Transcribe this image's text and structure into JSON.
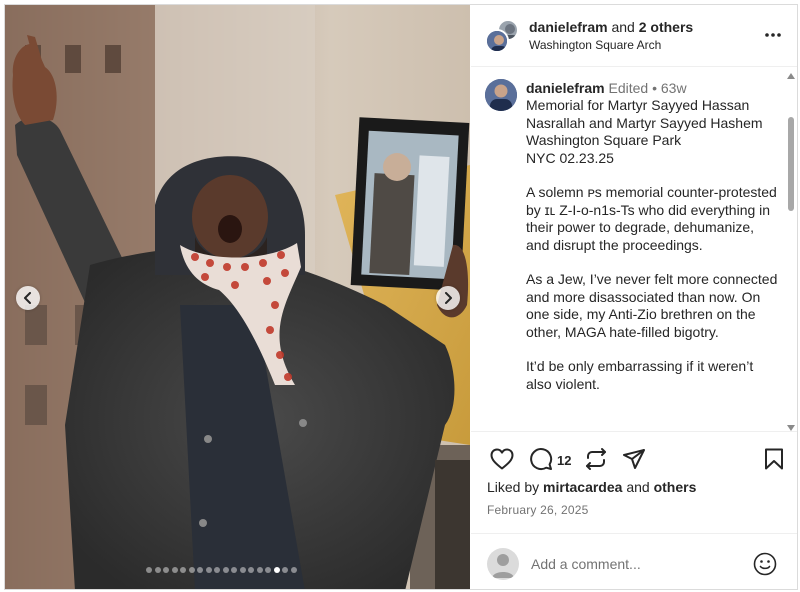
{
  "header": {
    "username": "danielefram",
    "joiner": " and ",
    "others": "2 others",
    "location": "Washington Square Arch",
    "more_icon": "more-horizontal-icon"
  },
  "caption": {
    "username": "danielefram",
    "edited": " Edited",
    "separator": " • ",
    "age": "63w",
    "paragraphs": [
      "Memorial for Martyr Sayyed Hassan Nasrallah and Martyr Sayyed Hashem\nWashington Square Park\nNYC 02.23.25",
      "A solemn ᴘs memorial counter-protested by ɪʟ Z-I-o-n1s-Ts who did everything in their power to degrade, dehumanize, and disrupt the proceedings.",
      "As a Jew, I’ve never felt more connected and more disassociated than now. On one side, my Anti-Zio brethren on the other, MAGA hate-filled bigotry.",
      "It’d be only embarrassing if it weren’t also violent."
    ]
  },
  "media": {
    "slide_count": 18,
    "active_slide": 15,
    "prev_icon": "chevron-left-icon",
    "next_icon": "chevron-right-icon"
  },
  "actions": {
    "comment_count": "12",
    "icons": [
      "heart-icon",
      "comment-icon",
      "repost-icon",
      "share-icon",
      "bookmark-icon"
    ]
  },
  "likes": {
    "prefix": "Liked by ",
    "user": "mirtacardea",
    "joiner": " and ",
    "others": "others"
  },
  "date": "February 26, 2025",
  "comment_box": {
    "placeholder": "Add a comment...",
    "emoji_icon": "emoji-smile-icon"
  },
  "colors": {
    "text": "#262626",
    "secondary_text": "#737373",
    "divider": "#efefef",
    "scarf_red": "#c0392b"
  }
}
